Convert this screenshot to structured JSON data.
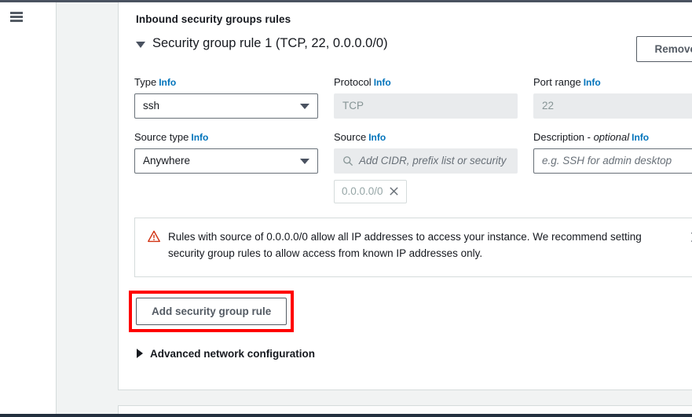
{
  "nav": {
    "menu_icon": "hamburger-menu-icon"
  },
  "section": {
    "title": "Inbound security groups rules"
  },
  "rule": {
    "expand_icon": "triangle-down-icon",
    "title": "Security group rule 1 (TCP, 22, 0.0.0.0/0)",
    "remove_label": "Remove"
  },
  "fields": {
    "type": {
      "label": "Type",
      "info": "Info",
      "value": "ssh",
      "caret_icon": "chevron-down-icon"
    },
    "protocol": {
      "label": "Protocol",
      "info": "Info",
      "value": "TCP"
    },
    "port_range": {
      "label": "Port range",
      "info": "Info",
      "value": "22"
    },
    "source_type": {
      "label": "Source type",
      "info": "Info",
      "value": "Anywhere",
      "caret_icon": "chevron-down-icon"
    },
    "source": {
      "label": "Source",
      "info": "Info",
      "placeholder": "Add CIDR, prefix list or security",
      "search_icon": "search-icon",
      "token_value": "0.0.0.0/0",
      "token_remove_icon": "close-icon"
    },
    "description": {
      "label": "Description - ",
      "label_optional": "optional",
      "info": "Info",
      "placeholder": "e.g. SSH for admin desktop"
    }
  },
  "alert": {
    "icon": "warning-triangle-icon",
    "text": "Rules with source of 0.0.0.0/0 allow all IP addresses to access your instance. We recommend setting security group rules to allow access from known IP addresses only.",
    "close_icon": "close-icon",
    "icon_color": "#d13212"
  },
  "actions": {
    "add_rule_label": "Add security group rule",
    "highlight_color": "#ff0000"
  },
  "advanced": {
    "expand_icon": "triangle-right-icon",
    "label": "Advanced network configuration"
  },
  "colors": {
    "link": "#0073bb",
    "text": "#16191f",
    "border": "#d5dbdb",
    "disabled_bg": "#e9ebed"
  }
}
